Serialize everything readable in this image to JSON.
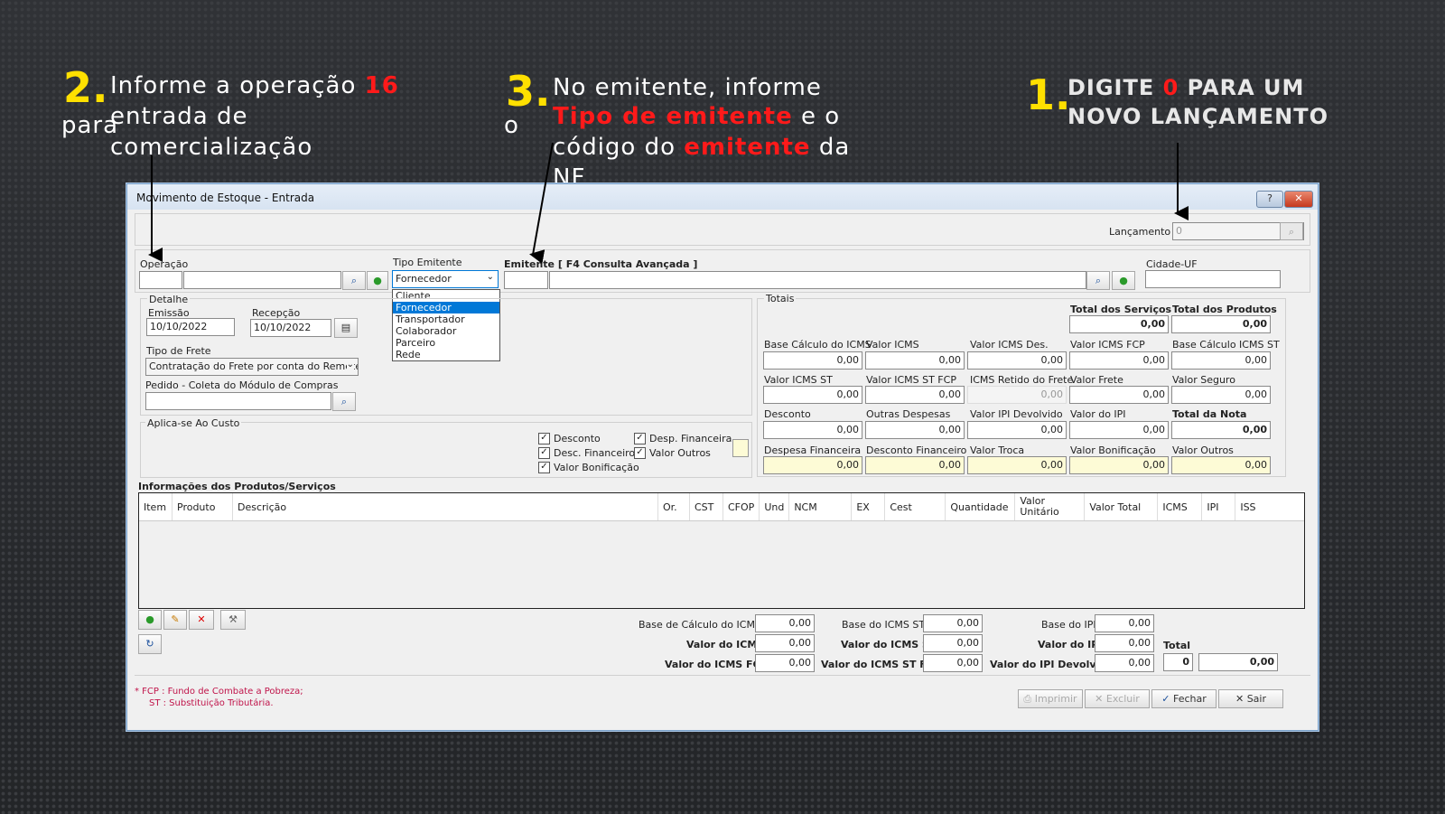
{
  "annotations": {
    "step2": {
      "num": "2.",
      "line1": " Informe a operação ",
      "op": "16",
      "line2a": "para",
      "line2b": "entrada de",
      "line3": "comercialização"
    },
    "step3": {
      "num": "3.",
      "line1": " No emitente, informe",
      "line2a": "o",
      "line2b_red": "Tipo de emitente",
      "line2c": " e o",
      "line3a": "código do ",
      "line3_red": "emitente",
      "line3c": " da",
      "line4": "NF"
    },
    "step1": {
      "num": "1.",
      "line1a": "DIGITE ",
      "zero": "0",
      "line1b": " PARA UM",
      "line2": "NOVO LANÇAMENTO"
    }
  },
  "window": {
    "title": "Movimento de Estoque - Entrada",
    "help_btn": "?",
    "close_btn": "✕"
  },
  "header": {
    "lancamento_label": "Lançamento",
    "lancamento_value": "0"
  },
  "operacao": {
    "label": "Operação",
    "code": "",
    "desc": ""
  },
  "tipo_emitente": {
    "label": "Tipo Emitente",
    "selected": "Fornecedor",
    "options": [
      "Cliente",
      "Fornecedor",
      "Transportador",
      "Colaborador",
      "Parceiro",
      "Rede"
    ]
  },
  "emitente": {
    "label": "Emitente [ F4 Consulta Avançada ]",
    "code": "",
    "name": ""
  },
  "cidade_uf": {
    "label": "Cidade-UF",
    "value": ""
  },
  "detalhe": {
    "legend": "Detalhe",
    "emissao_label": "Emissão",
    "emissao": "10/10/2022",
    "recepcao_label": "Recepção",
    "recepcao": "10/10/2022",
    "frete_label": "Tipo de Frete",
    "frete": "Contratação do Frete por conta do Remetei",
    "pedido_label": "Pedido - Coleta do Módulo de Compras",
    "pedido": ""
  },
  "aplica": {
    "legend": "Aplica-se Ao Custo",
    "items": [
      {
        "label": "Desconto",
        "checked": "✓"
      },
      {
        "label": "Desp. Financeira",
        "checked": "✓"
      },
      {
        "label": "Desc. Financeiro",
        "checked": "✓"
      },
      {
        "label": "Valor Outros",
        "checked": "✓"
      },
      {
        "label": "Valor Bonificação",
        "checked": "✓"
      }
    ]
  },
  "totais": {
    "legend": "Totais",
    "total_servicos_label": "Total dos Serviços",
    "total_servicos": "0,00",
    "total_produtos_label": "Total dos Produtos",
    "total_produtos": "0,00",
    "row1": [
      {
        "label": "Base Cálculo do ICMS",
        "value": "0,00"
      },
      {
        "label": "Valor ICMS",
        "value": "0,00"
      },
      {
        "label": "Valor ICMS Des.",
        "value": "0,00"
      },
      {
        "label": "Valor ICMS FCP",
        "value": "0,00"
      },
      {
        "label": "Base Cálculo ICMS ST",
        "value": "0,00"
      }
    ],
    "row2": [
      {
        "label": "Valor ICMS ST",
        "value": "0,00"
      },
      {
        "label": "Valor ICMS ST FCP",
        "value": "0,00"
      },
      {
        "label": "ICMS Retido do Frete",
        "value": "0,00"
      },
      {
        "label": "Valor Frete",
        "value": "0,00"
      },
      {
        "label": "Valor Seguro",
        "value": "0,00"
      }
    ],
    "row3": [
      {
        "label": "Desconto",
        "value": "0,00"
      },
      {
        "label": "Outras Despesas",
        "value": "0,00"
      },
      {
        "label": "Valor IPI Devolvido",
        "value": "0,00"
      },
      {
        "label": "Valor do IPI",
        "value": "0,00"
      },
      {
        "label": "Total da Nota",
        "value": "0,00"
      }
    ],
    "row4": [
      {
        "label": "Despesa Financeira",
        "value": "0,00"
      },
      {
        "label": "Desconto Financeiro",
        "value": "0,00"
      },
      {
        "label": "Valor Troca",
        "value": "0,00"
      },
      {
        "label": "Valor Bonificação",
        "value": "0,00"
      },
      {
        "label": "Valor Outros",
        "value": "0,00"
      }
    ]
  },
  "produtos": {
    "title": "Informações dos Produtos/Serviços",
    "columns": [
      "Item",
      "Produto",
      "Descrição",
      "Or.",
      "CST",
      "CFOP",
      "Und",
      "NCM",
      "EX",
      "Cest",
      "Quantidade",
      "Valor Unitário",
      "Valor Total",
      "ICMS",
      "IPI",
      "ISS"
    ]
  },
  "rodape": {
    "base_icms_label": "Base de Cálculo do ICMS",
    "base_icms": "0,00",
    "valor_icms_label": "Valor do ICMS",
    "valor_icms": "0,00",
    "valor_icms_fcp_label": "Valor do ICMS FCP",
    "valor_icms_fcp": "0,00",
    "base_st_label": "Base do ICMS ST",
    "base_st": "0,00",
    "valor_st_label": "Valor do ICMS ST",
    "valor_st": "0,00",
    "valor_st_fcp_label": "Valor do ICMS ST FCP",
    "valor_st_fcp": "0,00",
    "base_ipi_label": "Base do IPI",
    "base_ipi": "0,00",
    "valor_ipi_label": "Valor do IPI",
    "valor_ipi": "0,00",
    "ipi_dev_label": "Valor do IPI Devolvido",
    "ipi_dev": "0,00",
    "total_label": "Total",
    "total_qtd": "0",
    "total": "0,00"
  },
  "notes": {
    "fcp": "* FCP : Fundo de Combate a Pobreza;",
    "st": "ST : Substituição Tributária."
  },
  "actions": {
    "imprimir": "Imprimir",
    "excluir": "Excluir",
    "fechar": "Fechar",
    "sair": "Sair"
  }
}
